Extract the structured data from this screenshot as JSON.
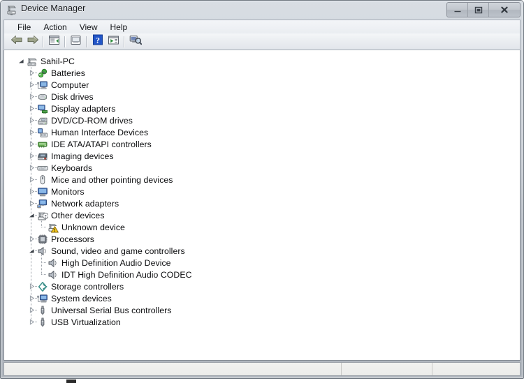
{
  "window": {
    "title": "Device Manager",
    "icon": "device-manager-icon",
    "controls": {
      "minimize_label": "Minimize",
      "maximize_label": "Maximize",
      "close_label": "Close"
    }
  },
  "menubar": {
    "items": [
      {
        "label": "File"
      },
      {
        "label": "Action"
      },
      {
        "label": "View"
      },
      {
        "label": "Help"
      }
    ]
  },
  "toolbar": {
    "buttons": [
      {
        "name": "back-button",
        "icon": "back-arrow-icon",
        "label": "Back"
      },
      {
        "name": "forward-button",
        "icon": "forward-arrow-icon",
        "label": "Forward"
      },
      {
        "name": "show-hide-console-tree-button",
        "icon": "console-tree-icon",
        "label": "Show/Hide Console Tree"
      },
      {
        "name": "properties-button",
        "icon": "properties-icon",
        "label": "Properties"
      },
      {
        "name": "help-button",
        "icon": "help-question-icon",
        "label": "Help"
      },
      {
        "name": "update-driver-button",
        "icon": "update-driver-icon",
        "label": "Update Driver Software"
      },
      {
        "name": "scan-for-hardware-changes-button",
        "icon": "scan-hardware-icon",
        "label": "Scan for hardware changes"
      }
    ]
  },
  "tree": {
    "nodes": [
      {
        "label": "Sahil-PC",
        "level": 0,
        "state": "expanded",
        "icon": "computer-tower-icon"
      },
      {
        "label": "Batteries",
        "level": 1,
        "state": "collapsed",
        "icon": "battery-icon"
      },
      {
        "label": "Computer",
        "level": 1,
        "state": "collapsed",
        "icon": "computer-icon"
      },
      {
        "label": "Disk drives",
        "level": 1,
        "state": "collapsed",
        "icon": "disk-drive-icon"
      },
      {
        "label": "Display adapters",
        "level": 1,
        "state": "collapsed",
        "icon": "display-adapter-icon"
      },
      {
        "label": "DVD/CD-ROM drives",
        "level": 1,
        "state": "collapsed",
        "icon": "dvd-drive-icon"
      },
      {
        "label": "Human Interface Devices",
        "level": 1,
        "state": "collapsed",
        "icon": "hid-icon"
      },
      {
        "label": "IDE ATA/ATAPI controllers",
        "level": 1,
        "state": "collapsed",
        "icon": "ide-controller-icon"
      },
      {
        "label": "Imaging devices",
        "level": 1,
        "state": "collapsed",
        "icon": "imaging-device-icon"
      },
      {
        "label": "Keyboards",
        "level": 1,
        "state": "collapsed",
        "icon": "keyboard-icon"
      },
      {
        "label": "Mice and other pointing devices",
        "level": 1,
        "state": "collapsed",
        "icon": "mouse-icon"
      },
      {
        "label": "Monitors",
        "level": 1,
        "state": "collapsed",
        "icon": "monitor-icon"
      },
      {
        "label": "Network adapters",
        "level": 1,
        "state": "collapsed",
        "icon": "network-adapter-icon"
      },
      {
        "label": "Other devices",
        "level": 1,
        "state": "expanded",
        "icon": "unknown-device-icon"
      },
      {
        "label": "Unknown device",
        "level": 2,
        "state": "leaf",
        "icon": "unknown-device-warning-icon"
      },
      {
        "label": "Processors",
        "level": 1,
        "state": "collapsed",
        "icon": "processor-icon"
      },
      {
        "label": "Sound, video and game controllers",
        "level": 1,
        "state": "expanded",
        "icon": "speaker-icon"
      },
      {
        "label": "High Definition Audio Device",
        "level": 2,
        "state": "leaf",
        "icon": "speaker-icon"
      },
      {
        "label": "IDT High Definition Audio CODEC",
        "level": 2,
        "state": "leaf",
        "icon": "speaker-icon"
      },
      {
        "label": "Storage controllers",
        "level": 1,
        "state": "collapsed",
        "icon": "storage-controller-icon"
      },
      {
        "label": "System devices",
        "level": 1,
        "state": "collapsed",
        "icon": "system-device-icon"
      },
      {
        "label": "Universal Serial Bus controllers",
        "level": 1,
        "state": "collapsed",
        "icon": "usb-icon"
      },
      {
        "label": "USB Virtualization",
        "level": 1,
        "state": "collapsed",
        "icon": "usb-icon"
      }
    ]
  },
  "statusbar": {
    "panes": [
      "",
      "",
      ""
    ]
  },
  "colors": {
    "titlebar_start": "#d8dde3",
    "titlebar_end": "#b0b6be",
    "client_background": "#ffffff",
    "text": "#0b0c0e",
    "help_badge": "#2255c8",
    "warning_badge": "#f2c21a"
  }
}
